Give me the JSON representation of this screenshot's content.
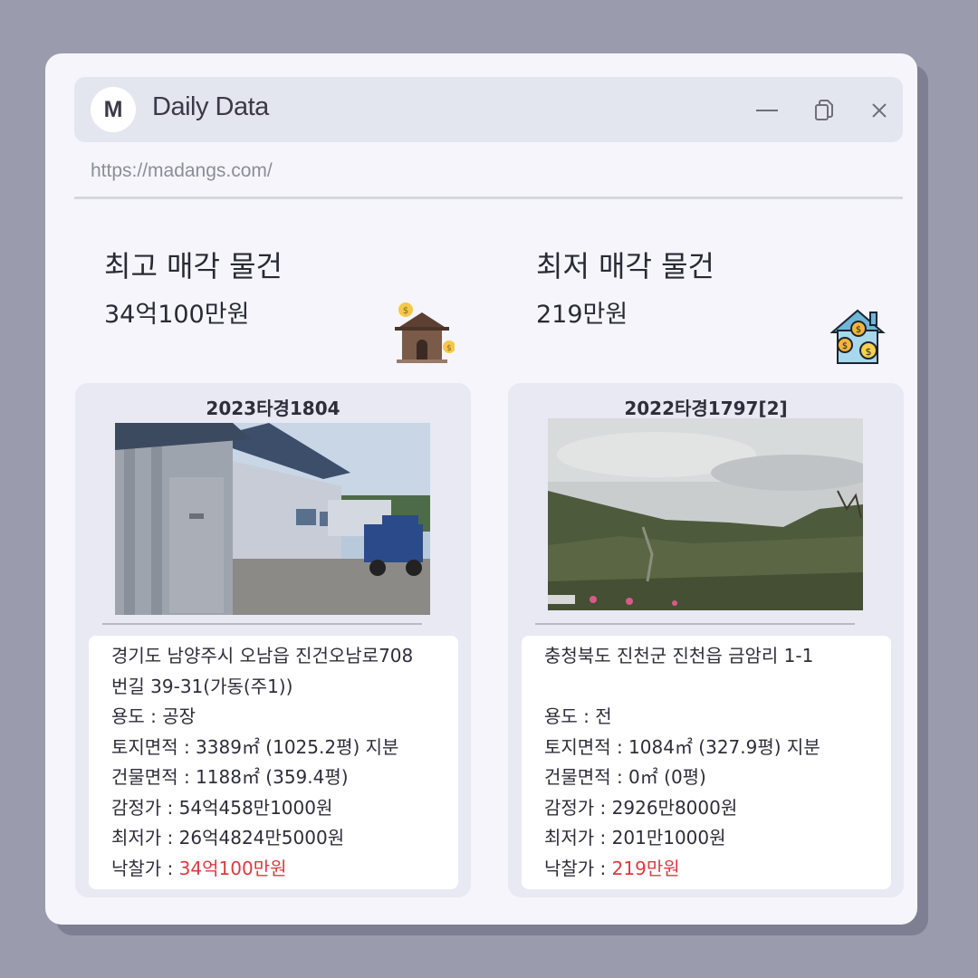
{
  "window": {
    "logo_letter": "M",
    "title": "Daily Data",
    "url": "https://madangs.com/"
  },
  "highest": {
    "heading": "최고 매각 물건",
    "price": "34억100만원",
    "icon": "house-coins-icon",
    "case_no": "2023타경1804",
    "photo": "warehouse-building-photo",
    "address_line1": "경기도 남양주시 오남읍 진건오남로708",
    "address_line2": "번길 39-31(가동(주1))",
    "usage": "용도 : 공장",
    "land_area": "토지면적 : 3389㎡ (1025.2평) 지분",
    "building_area": "건물면적 : 1188㎡ (359.4평)",
    "appraisal": "감정가 : 54억458만1000원",
    "minimum": "최저가 : 26억4824만5000원",
    "winning_label": "낙찰가 : ",
    "winning_value": "34억100만원"
  },
  "lowest": {
    "heading": "최저 매각 물건",
    "price": "219만원",
    "icon": "house-dollar-icon",
    "case_no": "2022타경1797[2]",
    "photo": "hillside-field-photo",
    "address_line1": "충청북도 진천군 진천읍 금암리 1-1",
    "usage": "용도 : 전",
    "land_area": "토지면적 : 1084㎡ (327.9평) 지분",
    "building_area": "건물면적 : 0㎡ (0평)",
    "appraisal": "감정가 : 2926만8000원",
    "minimum": "최저가 : 201만1000원",
    "winning_label": "낙찰가 : ",
    "winning_value": "219만원"
  },
  "colors": {
    "background": "#9a9bad",
    "window": "#f5f5fb",
    "titlebar": "#e4e6ef",
    "card": "#e8e9f3",
    "accent_red": "#e0383f"
  }
}
